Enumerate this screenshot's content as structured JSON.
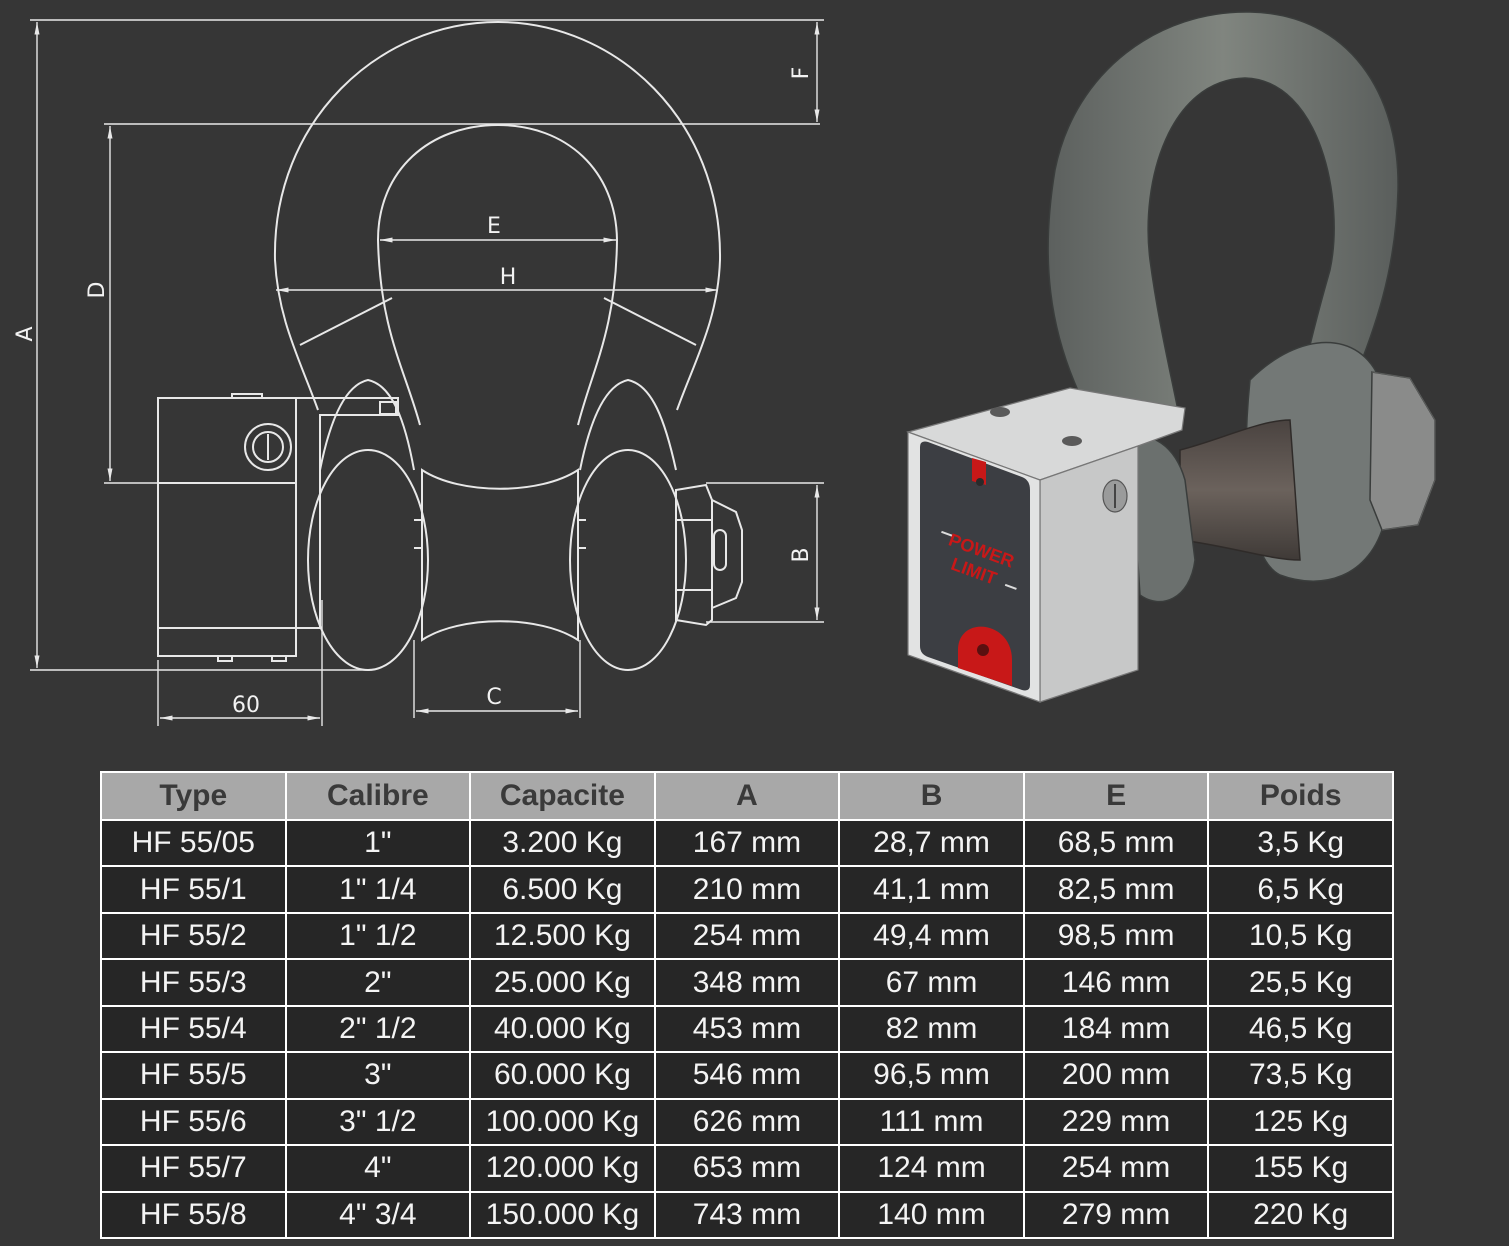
{
  "drawing": {
    "dimension_labels": {
      "A": "A",
      "B": "B",
      "C": "C",
      "D": "D",
      "E": "E",
      "F": "F",
      "H": "H",
      "width": "60"
    },
    "logo": {
      "line1": "POWER",
      "line2": "LIMIT"
    },
    "colors": {
      "background": "#363636",
      "line": "#e8e8e8",
      "shackle": "#6b706e",
      "body": "#cfd0d0",
      "face": "#3c3e43",
      "brand_red": "#c81818"
    }
  },
  "table": {
    "headers": [
      "Type",
      "Calibre",
      "Capacite",
      "A",
      "B",
      "E",
      "Poids"
    ],
    "rows": [
      [
        "HF 55/05",
        "1\"",
        "3.200 Kg",
        "167 mm",
        "28,7 mm",
        "68,5 mm",
        "3,5 Kg"
      ],
      [
        "HF 55/1",
        "1\" 1/4",
        "6.500 Kg",
        "210 mm",
        "41,1 mm",
        "82,5 mm",
        "6,5 Kg"
      ],
      [
        "HF 55/2",
        "1\" 1/2",
        "12.500 Kg",
        "254 mm",
        "49,4 mm",
        "98,5 mm",
        "10,5 Kg"
      ],
      [
        "HF 55/3",
        "2\"",
        "25.000 Kg",
        "348 mm",
        "67 mm",
        "146 mm",
        "25,5 Kg"
      ],
      [
        "HF 55/4",
        "2\" 1/2",
        "40.000 Kg",
        "453 mm",
        "82 mm",
        "184 mm",
        "46,5 Kg"
      ],
      [
        "HF 55/5",
        "3\"",
        "60.000 Kg",
        "546 mm",
        "96,5 mm",
        "200 mm",
        "73,5 Kg"
      ],
      [
        "HF 55/6",
        "3\" 1/2",
        "100.000 Kg",
        "626 mm",
        "111 mm",
        "229 mm",
        "125 Kg"
      ],
      [
        "HF 55/7",
        "4\"",
        "120.000 Kg",
        "653 mm",
        "124 mm",
        "254 mm",
        "155 Kg"
      ],
      [
        "HF 55/8",
        "4\" 3/4",
        "150.000 Kg",
        "743 mm",
        "140 mm",
        "279 mm",
        "220 Kg"
      ]
    ]
  }
}
